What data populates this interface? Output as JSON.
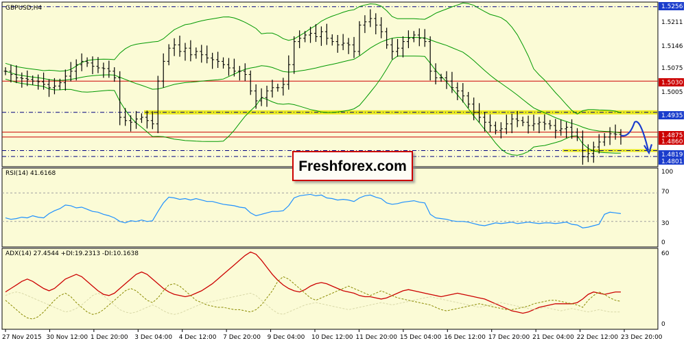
{
  "chart_data": [
    {
      "panel": "price",
      "type": "candlestick",
      "title": "GBPUSD,H4",
      "ylim": [
        1.477,
        1.527
      ],
      "y_ticks": [
        1.5256,
        1.5211,
        1.5146,
        1.5075,
        1.503,
        1.5005,
        1.4935,
        1.4875,
        1.486,
        1.4819,
        1.4801
      ],
      "x_labels": [
        "27 Nov 2015",
        "30 Nov 12:00",
        "1 Dec 20:00",
        "3 Dec 04:00",
        "4 Dec 12:00",
        "7 Dec 20:00",
        "9 Dec 04:00",
        "10 Dec 12:00",
        "11 Dec 20:00",
        "15 Dec 04:00",
        "16 Dec 12:00",
        "17 Dec 20:00",
        "21 Dec 04:00",
        "22 Dec 12:00",
        "23 Dec 20:00"
      ],
      "close": [
        1.506,
        1.505,
        1.504,
        1.5038,
        1.5035,
        1.503,
        1.5028,
        1.502,
        1.501,
        1.5015,
        1.5025,
        1.5045,
        1.506,
        1.508,
        1.509,
        1.5085,
        1.5075,
        1.507,
        1.5068,
        1.506,
        1.504,
        1.492,
        1.491,
        1.4905,
        1.4915,
        1.492,
        1.491,
        1.49,
        1.503,
        1.509,
        1.513,
        1.514,
        1.512,
        1.513,
        1.511,
        1.512,
        1.511,
        1.51,
        1.5095,
        1.509,
        1.508,
        1.507,
        1.506,
        1.506,
        1.505,
        1.5,
        1.497,
        1.498,
        1.5,
        1.501,
        1.501,
        1.502,
        1.508,
        1.515,
        1.516,
        1.517,
        1.5175,
        1.5165,
        1.518,
        1.516,
        1.515,
        1.514,
        1.5145,
        1.514,
        1.512,
        1.52,
        1.521,
        1.522,
        1.52,
        1.518,
        1.514,
        1.512,
        1.513,
        1.515,
        1.516,
        1.517,
        1.516,
        1.515,
        1.506,
        1.504,
        1.504,
        1.503,
        1.501,
        1.5,
        1.4985,
        1.496,
        1.4935,
        1.492,
        1.4905,
        1.4895,
        1.488,
        1.4885,
        1.49,
        1.4915,
        1.491,
        1.4905,
        1.4895,
        1.49,
        1.4905,
        1.49,
        1.4895,
        1.488,
        1.4885,
        1.489,
        1.4875,
        1.486,
        1.48,
        1.481,
        1.483,
        1.4845,
        1.486,
        1.487,
        1.4868,
        1.4865
      ],
      "overlay_lines": [
        "bollinger-upper",
        "bollinger-middle",
        "bollinger-lower"
      ],
      "support_zones": [
        1.4935,
        1.4819
      ],
      "legend": "none",
      "grid": false
    },
    {
      "panel": "rsi",
      "type": "line",
      "title": "RSI(14) 41.6168",
      "ylim": [
        0,
        100
      ],
      "y_ticks": [
        100,
        70,
        30,
        0
      ],
      "levels": [
        70,
        30
      ],
      "values": [
        35,
        33,
        34,
        36,
        35,
        38,
        36,
        35,
        41,
        45,
        48,
        53,
        52,
        49,
        50,
        47,
        44,
        43,
        40,
        38,
        35,
        30,
        28,
        31,
        30,
        32,
        30,
        31,
        44,
        56,
        64,
        63,
        61,
        62,
        60,
        62,
        60,
        58,
        58,
        56,
        54,
        53,
        52,
        50,
        49,
        42,
        38,
        40,
        42,
        44,
        44,
        45,
        52,
        63,
        66,
        67,
        68,
        66,
        67,
        63,
        62,
        60,
        61,
        60,
        58,
        63,
        66,
        67,
        64,
        62,
        56,
        54,
        55,
        57,
        58,
        59,
        57,
        56,
        40,
        35,
        34,
        33,
        31,
        30,
        30,
        29,
        27,
        25,
        24,
        26,
        28,
        27,
        28,
        29,
        27,
        28,
        29,
        28,
        27,
        28,
        28,
        27,
        28,
        29,
        26,
        25,
        21,
        22,
        24,
        26,
        40,
        43,
        42,
        41
      ]
    },
    {
      "panel": "adx",
      "type": "line",
      "title": "ADX(14) 27.4544 +DI:19.2313 -DI:10.1638",
      "ylim": [
        0,
        60
      ],
      "y_ticks": [
        60,
        0
      ],
      "series": [
        {
          "name": "ADX",
          "color": "#cc0000",
          "values": [
            27,
            30,
            33,
            36,
            38,
            36,
            33,
            30,
            28,
            30,
            34,
            38,
            40,
            42,
            40,
            36,
            32,
            28,
            25,
            24,
            26,
            30,
            34,
            38,
            42,
            44,
            42,
            38,
            34,
            30,
            27,
            25,
            24,
            23,
            24,
            26,
            28,
            31,
            34,
            38,
            42,
            46,
            50,
            54,
            58,
            61,
            59,
            54,
            48,
            42,
            37,
            33,
            30,
            28,
            27,
            29,
            32,
            34,
            35,
            34,
            32,
            30,
            28,
            27,
            26,
            24,
            23,
            23,
            22,
            21,
            22,
            24,
            26,
            28,
            29,
            28,
            27,
            26,
            25,
            24,
            23,
            24,
            25,
            26,
            25,
            24,
            23,
            22,
            21,
            19,
            17,
            15,
            13,
            11,
            10,
            9,
            10,
            12,
            14,
            15,
            16,
            17,
            17,
            17,
            17,
            18,
            21,
            25,
            27,
            26,
            25,
            26,
            27,
            27
          ]
        },
        {
          "name": "+DI",
          "color": "#8a8a00",
          "values": [
            20,
            16,
            12,
            8,
            5,
            4,
            6,
            10,
            15,
            20,
            24,
            26,
            23,
            18,
            14,
            10,
            8,
            9,
            12,
            16,
            20,
            24,
            28,
            30,
            28,
            24,
            20,
            18,
            22,
            28,
            33,
            34,
            32,
            28,
            24,
            20,
            18,
            16,
            15,
            14,
            14,
            13,
            12,
            12,
            11,
            10,
            12,
            16,
            22,
            28,
            36,
            40,
            38,
            34,
            30,
            26,
            22,
            20,
            22,
            24,
            26,
            28,
            30,
            32,
            30,
            28,
            26,
            24,
            26,
            28,
            26,
            24,
            22,
            21,
            20,
            19,
            18,
            17,
            16,
            14,
            12,
            11,
            12,
            13,
            14,
            15,
            16,
            17,
            16,
            15,
            14,
            13,
            12,
            12,
            13,
            14,
            15,
            17,
            18,
            19,
            20,
            20,
            19,
            18,
            17,
            16,
            14,
            20,
            24,
            27,
            25,
            22,
            20,
            19
          ]
        },
        {
          "name": "-DI",
          "color": "#d8d8a8",
          "values": [
            24,
            26,
            27,
            26,
            24,
            22,
            20,
            18,
            16,
            14,
            12,
            10,
            11,
            13,
            16,
            20,
            24,
            26,
            24,
            20,
            16,
            12,
            10,
            9,
            10,
            12,
            14,
            16,
            14,
            11,
            9,
            8,
            9,
            11,
            13,
            15,
            17,
            18,
            19,
            20,
            21,
            22,
            23,
            24,
            25,
            26,
            24,
            20,
            16,
            12,
            9,
            8,
            10,
            12,
            14,
            16,
            17,
            18,
            17,
            16,
            15,
            14,
            13,
            12,
            13,
            14,
            15,
            16,
            17,
            18,
            17,
            16,
            17,
            18,
            19,
            20,
            21,
            22,
            23,
            22,
            21,
            20,
            19,
            18,
            17,
            16,
            15,
            14,
            15,
            16,
            17,
            18,
            17,
            16,
            15,
            14,
            13,
            12,
            13,
            14,
            13,
            12,
            11,
            12,
            13,
            12,
            11,
            10,
            11,
            12,
            11,
            10,
            10,
            10
          ]
        }
      ]
    }
  ],
  "tags": {
    "t1": "1.5256",
    "t2": "1.5211",
    "t3": "1.5146",
    "t4": "1.5075",
    "t5": "1.5030",
    "t6": "1.5005",
    "t7": "1.4935",
    "t8": "1.4875",
    "t9": "1.4860",
    "t10": "1.4819",
    "t11": "1.4801"
  },
  "rsi_ticks": {
    "a": "100",
    "b": "70",
    "c": "30",
    "d": "0"
  },
  "adx_ticks": {
    "a": "60",
    "b": "0"
  },
  "watermark": "Freshforex.com",
  "colors": {
    "background": "#fbfbd6",
    "bb_band": "#009900",
    "rsi_line": "#1e90ff",
    "red_level": "#cc0000",
    "blue_level": "#000080",
    "yellow_zone": "#e6e600",
    "forecast_arrow": "#1a3ccc"
  }
}
